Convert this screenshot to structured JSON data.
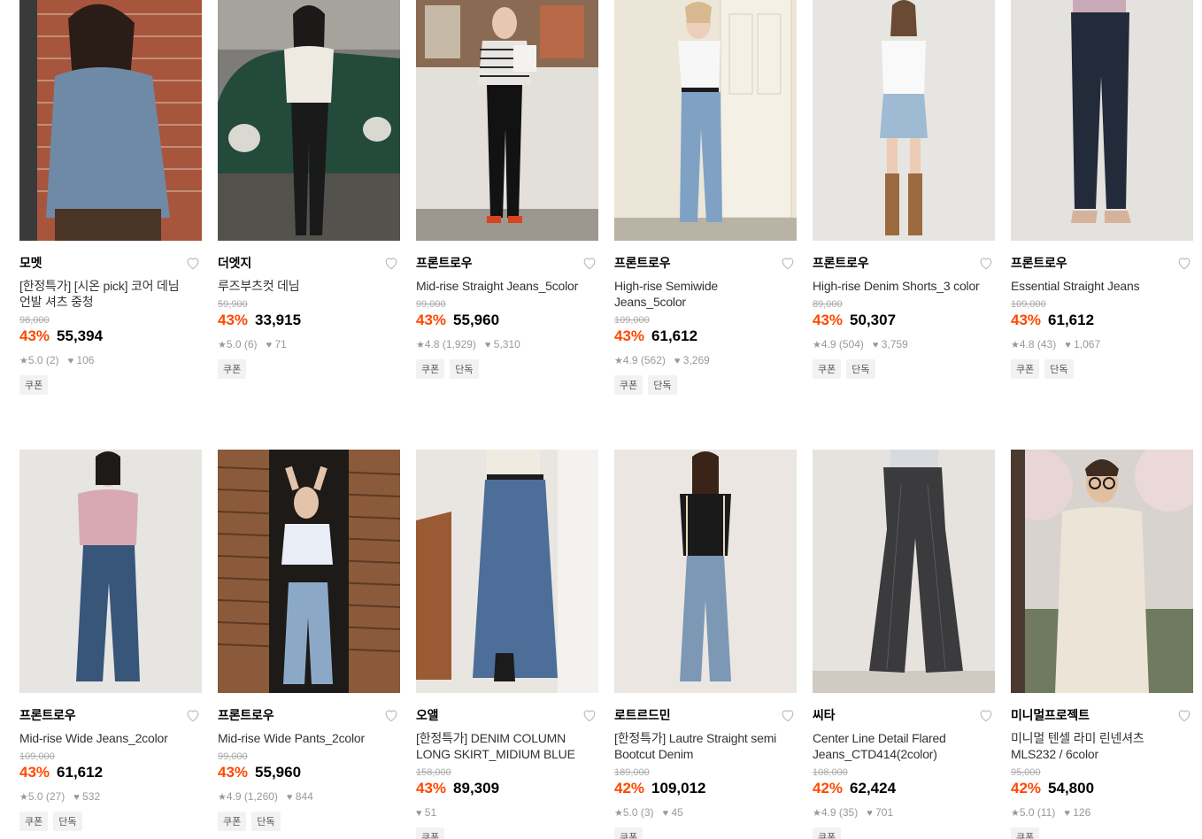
{
  "row1": [
    {
      "brand": "모멧",
      "name": "[한정특가] [시온 pick] 코어 데님 언발 셔츠 중청",
      "original": "98,000",
      "discount": "43%",
      "price": "55,394",
      "rating": "5.0 (2)",
      "likes": "106",
      "tags": [
        "쿠폰"
      ]
    },
    {
      "brand": "더엣지",
      "name": "루즈부츠컷 데님",
      "original": "59,900",
      "discount": "43%",
      "price": "33,915",
      "rating": "5.0 (6)",
      "likes": "71",
      "tags": [
        "쿠폰"
      ]
    },
    {
      "brand": "프론트로우",
      "name": "Mid-rise Straight Jeans_5color",
      "original": "99,000",
      "discount": "43%",
      "price": "55,960",
      "rating": "4.8 (1,929)",
      "likes": "5,310",
      "tags": [
        "쿠폰",
        "단독"
      ]
    },
    {
      "brand": "프론트로우",
      "name": "High-rise Semiwide Jeans_5color",
      "original": "109,000",
      "discount": "43%",
      "price": "61,612",
      "rating": "4.9 (562)",
      "likes": "3,269",
      "tags": [
        "쿠폰",
        "단독"
      ]
    },
    {
      "brand": "프론트로우",
      "name": "High-rise Denim Shorts_3 color",
      "original": "89,000",
      "discount": "43%",
      "price": "50,307",
      "rating": "4.9 (504)",
      "likes": "3,759",
      "tags": [
        "쿠폰",
        "단독"
      ]
    },
    {
      "brand": "프론트로우",
      "name": "Essential Straight Jeans",
      "original": "109,000",
      "discount": "43%",
      "price": "61,612",
      "rating": "4.8 (43)",
      "likes": "1,067",
      "tags": [
        "쿠폰",
        "단독"
      ]
    }
  ],
  "row2": [
    {
      "brand": "프론트로우",
      "name": "Mid-rise Wide Jeans_2color",
      "original": "109,000",
      "discount": "43%",
      "price": "61,612",
      "rating": "5.0 (27)",
      "likes": "532",
      "tags": [
        "쿠폰",
        "단독"
      ]
    },
    {
      "brand": "프론트로우",
      "name": "Mid-rise Wide Pants_2color",
      "original": "99,000",
      "discount": "43%",
      "price": "55,960",
      "rating": "4.9 (1,260)",
      "likes": "844",
      "tags": [
        "쿠폰",
        "단독"
      ]
    },
    {
      "brand": "오앨",
      "name": "[한정특가] DENIM COLUMN LONG SKIRT_MIDIUM BLUE",
      "original": "158,000",
      "discount": "43%",
      "price": "89,309",
      "rating": "",
      "likes": "51",
      "tags": [
        "쿠폰"
      ]
    },
    {
      "brand": "로트르드민",
      "name": "[한정특가] Lautre Straight semi Bootcut Denim",
      "original": "189,000",
      "discount": "42%",
      "price": "109,012",
      "rating": "5.0 (3)",
      "likes": "45",
      "tags": [
        "쿠폰"
      ]
    },
    {
      "brand": "씨타",
      "name": "Center Line Detail Flared Jeans_CTD414(2color)",
      "original": "108,000",
      "discount": "42%",
      "price": "62,424",
      "rating": "4.9 (35)",
      "likes": "701",
      "tags": [
        "쿠폰"
      ]
    },
    {
      "brand": "미니멀프로젝트",
      "name": "미니멀 텐셀 라미 린넨셔츠 MLS232 / 6color",
      "original": "95,000",
      "discount": "42%",
      "price": "54,800",
      "rating": "5.0 (11)",
      "likes": "126",
      "tags": [
        "쿠폰"
      ]
    }
  ],
  "colors": {
    "discount": "#ff4800",
    "strike": "#aaaaaa",
    "meta": "#999999",
    "tag_bg": "#f2f2f2"
  },
  "icons": {
    "wishlist": "heart-outline-icon",
    "rating": "star-icon",
    "likes": "heart-filled-icon"
  }
}
